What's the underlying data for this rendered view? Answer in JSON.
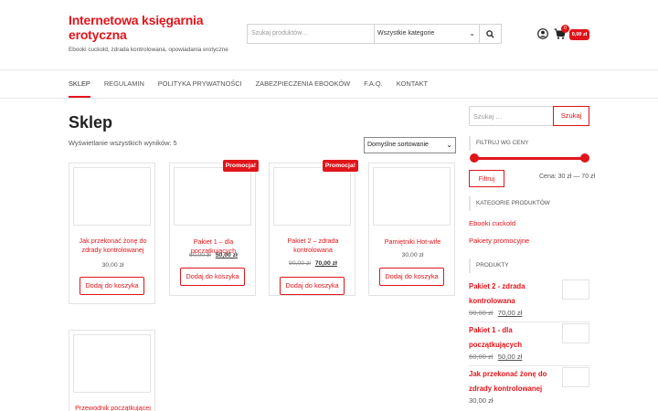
{
  "header": {
    "site_title": "Internetowa księgarnia erotyczna",
    "site_description": "Ebooki cuckold, zdrada kontrolowana, opowiadania erotyczne",
    "search_placeholder": "Szukaj produktów…",
    "category_select": "Wszystkie kategorie",
    "cart_count": "0",
    "cart_total": "0,00 zł",
    "accent_color": "#e0151b"
  },
  "nav": {
    "items": [
      "SKLEP",
      "REGULAMIN",
      "POLITYKA PRYWATNOŚCI",
      "ZABEZPIECZENIA EBOOKÓW",
      "F.A.Q.",
      "KONTAKT"
    ],
    "active": "SKLEP"
  },
  "main": {
    "title": "Sklep",
    "result_count": "Wyświetlanie wszystkich wyników: 5",
    "sort_selected": "Domyślne sortowanie",
    "products": [
      {
        "name": "Jak przekonać żonę do zdrady kontrolowanej",
        "price": "30,00 zł",
        "old_price": "",
        "sale": "",
        "button": "Dodaj do koszyka"
      },
      {
        "name": "Pakiet 1 – dla początkujących",
        "price": "50,00 zł",
        "old_price": "60,00 zł",
        "sale": "Promocja!",
        "button": "Dodaj do koszyka"
      },
      {
        "name": "Pakiet 2 – zdrada kontrolowana",
        "price": "70,00 zł",
        "old_price": "90,00 zł",
        "sale": "Promocja!",
        "button": "Dodaj do koszyka"
      },
      {
        "name": "Pamiętniki Hot-wife",
        "price": "30,00 zł",
        "old_price": "",
        "sale": "",
        "button": "Dodaj do koszyka"
      },
      {
        "name": "Przewodnik początkującej HOT-",
        "price": "",
        "old_price": "",
        "sale": "",
        "button": ""
      }
    ]
  },
  "sidebar": {
    "search_placeholder": "Szukaj …",
    "search_button": "Szukaj",
    "price_filter_title": "FILTRUJ WG CENY",
    "filter_button": "Filtruj",
    "price_range_text": "Cena: 30 zł — 70 zł",
    "categories_title": "KATEGORIE PRODUKTÓW",
    "categories": [
      "Ebooki cuckold",
      "Pakiety promocyjne"
    ],
    "products_title": "PRODUKTY",
    "products": [
      {
        "name": "Pakiet 2 - zdrada kontrolowana",
        "old_price": "90,00 zł",
        "price": "70,00 zł"
      },
      {
        "name": "Pakiet 1 - dla początkujących",
        "old_price": "60,00 zł",
        "price": "50,00 zł"
      },
      {
        "name": "Jak przekonać żonę do zdrady kontrolowanej",
        "old_price": "",
        "price": "30,00 zł"
      }
    ]
  }
}
